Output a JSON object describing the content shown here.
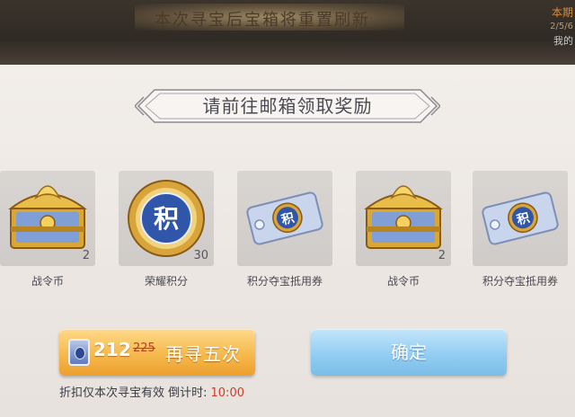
{
  "top": {
    "notice": "本次寻宝后宝箱将重置刷新",
    "side_line1": "本期",
    "side_line2": "2/5/6",
    "side_line3": "我的"
  },
  "dialog": {
    "title": "请前往邮箱领取奖励",
    "rewards": [
      {
        "name": "战令币",
        "qty": "2",
        "icon": "golden-chest-icon"
      },
      {
        "name": "荣耀积分",
        "qty": "30",
        "icon": "honor-points-medal-icon"
      },
      {
        "name": "积分夺宝抵用券",
        "qty": "",
        "icon": "voucher-ticket-icon"
      },
      {
        "name": "战令币",
        "qty": "2",
        "icon": "golden-chest-icon"
      },
      {
        "name": "积分夺宝抵用券",
        "qty": "",
        "icon": "voucher-ticket-icon"
      }
    ],
    "retry_button": {
      "price": "212",
      "old_price": "225",
      "label": "再寻五次"
    },
    "confirm_button": {
      "label": "确定"
    },
    "discount_note": "折扣仅本次寻宝有效 倒计时:",
    "countdown": "10:00"
  },
  "colors": {
    "panel_bg": "#efeae6",
    "accent_gold": "#f6b94c",
    "accent_blue": "#92cdf2",
    "timer_red": "#d23a2a"
  }
}
